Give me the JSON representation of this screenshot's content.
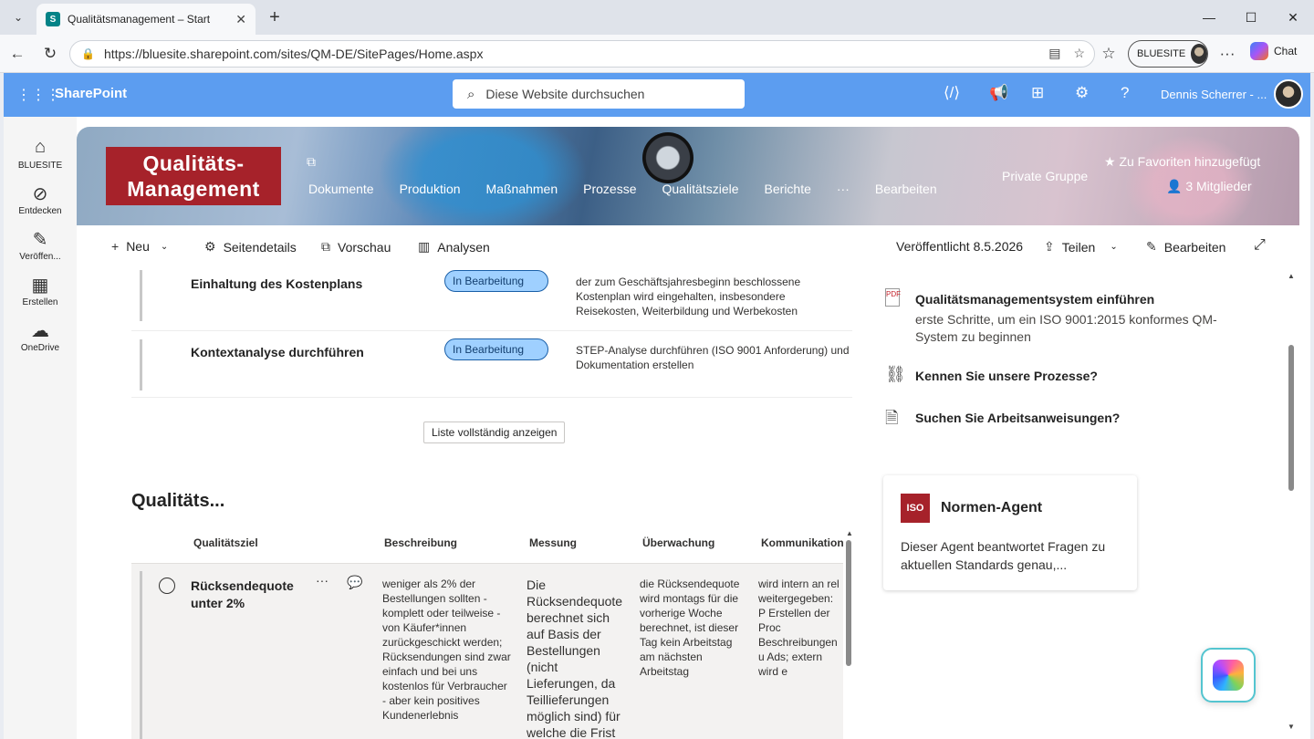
{
  "browser": {
    "tab_title": "Qualitätsmanagement – Start",
    "url": "https://bluesite.sharepoint.com/sites/QM-DE/SitePages/Home.aspx",
    "profile_label": "BLUESITE",
    "chat_label": "Chat"
  },
  "suite": {
    "brand": "SharePoint",
    "search_placeholder": "Diese Website durchsuchen",
    "user_name": "Dennis Scherrer - ..."
  },
  "rail": [
    {
      "label": "BLUESITE",
      "icon": "home-icon"
    },
    {
      "label": "Entdecken",
      "icon": "compass-icon"
    },
    {
      "label": "Veröffen...",
      "icon": "pen-icon"
    },
    {
      "label": "Erstellen",
      "icon": "layout-icon"
    },
    {
      "label": "OneDrive",
      "icon": "cloud-icon"
    }
  ],
  "hero": {
    "logo_line1": "Qualitäts-",
    "logo_line2": "Management",
    "nav": [
      "Dokumente",
      "Produktion",
      "Maßnahmen",
      "Prozesse",
      "Qualitätsziele",
      "Berichte",
      "···",
      "Bearbeiten"
    ],
    "privacy": "Private Gruppe",
    "favorite": "Zu Favoriten hinzugefügt",
    "members": "3 Mitglieder"
  },
  "commands": {
    "new": "Neu",
    "page_details": "Seitendetails",
    "preview": "Vorschau",
    "analytics": "Analysen",
    "published": "Veröffentlicht 8.5.2026",
    "share": "Teilen",
    "edit": "Bearbeiten"
  },
  "tasks": [
    {
      "title": "Einhaltung des Kostenplans",
      "status": "In Bearbeitung",
      "desc": "der zum Geschäftsjahresbeginn beschlossene Kostenplan wird eingehalten, insbesondere Reisekosten, Weiterbildung und Werbekosten"
    },
    {
      "title": "Kontextanalyse durchführen",
      "status": "In Bearbeitung",
      "desc": "STEP-Analyse durchführen (ISO 9001 Anforderung) und Dokumentation erstellen"
    }
  ],
  "show_all": "Liste vollständig anzeigen",
  "goals": {
    "title": "Qualitäts...",
    "headers": [
      "Qualitätsziel",
      "Beschreibung",
      "Messung",
      "Überwachung",
      "Kommunikation"
    ],
    "row": {
      "goal": "Rücksendequote unter 2%",
      "description": "weniger als 2% der Bestellungen sollten - komplett oder teilweise - von Käufer*innen zurückgeschickt werden; Rücksendungen sind zwar einfach und bei uns kostenlos für Verbraucher - aber kein positives Kundenerlebnis",
      "measurement": "Die Rücksendequote berechnet sich auf Basis der Bestellungen (nicht Lieferungen, da Teillieferungen möglich sind) für welche die Frist",
      "monitoring": "die Rücksendequote wird montags für die vorherige Woche berechnet, ist dieser Tag kein Arbeitstag am nächsten Arbeitstag",
      "communication": "wird intern an rel weitergegeben: P Erstellen der Proc Beschreibungen u Ads; extern wird e „Zufriedenheitsve den Kunden kom"
    }
  },
  "quicklinks": [
    {
      "title": "Qualitätsmanagementsystem einführen",
      "sub": "erste Schritte, um ein ISO 9001:2015 konformes QM-System zu beginnen",
      "icon": "pdf-icon"
    },
    {
      "title": "Kennen Sie unsere Prozesse?",
      "icon": "process-icon"
    },
    {
      "title": "Suchen Sie Arbeitsanweisungen?",
      "icon": "document-icon"
    }
  ],
  "agent": {
    "logo": "ISO",
    "name": "Normen-Agent",
    "desc": "Dieser Agent beantwortet Fragen zu aktuellen Standards genau,..."
  }
}
